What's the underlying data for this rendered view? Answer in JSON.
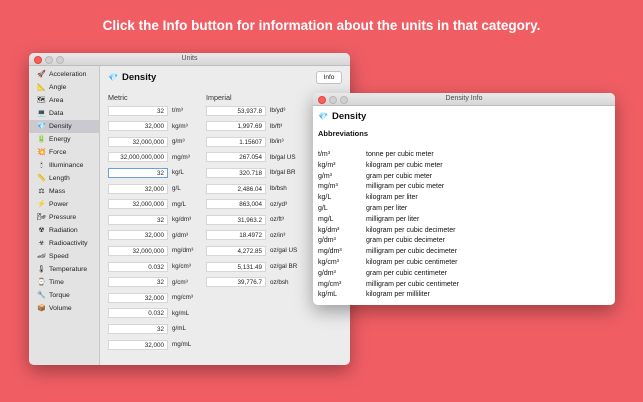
{
  "headline": "Click the Info button for information about the units in that category.",
  "colors": {
    "background": "#f05e64",
    "accent": "#6aa0e0",
    "selected_sidebar": "#c9c9cf"
  },
  "main_window": {
    "title": "Units",
    "sidebar": [
      {
        "label": "Acceleration",
        "icon": "rocket-icon",
        "glyph": "🚀"
      },
      {
        "label": "Angle",
        "icon": "angle-icon",
        "glyph": "📐"
      },
      {
        "label": "Area",
        "icon": "map-icon",
        "glyph": "🗺"
      },
      {
        "label": "Data",
        "icon": "monitor-icon",
        "glyph": "💻"
      },
      {
        "label": "Density",
        "icon": "diamond-icon",
        "glyph": "💎",
        "selected": true
      },
      {
        "label": "Energy",
        "icon": "battery-icon",
        "glyph": "🔋"
      },
      {
        "label": "Force",
        "icon": "force-icon",
        "glyph": "💥"
      },
      {
        "label": "Illuminance",
        "icon": "candle-icon",
        "glyph": "🕯"
      },
      {
        "label": "Length",
        "icon": "ruler-icon",
        "glyph": "📏"
      },
      {
        "label": "Mass",
        "icon": "scale-icon",
        "glyph": "⚖"
      },
      {
        "label": "Power",
        "icon": "power-icon",
        "glyph": "⚡"
      },
      {
        "label": "Pressure",
        "icon": "pressure-icon",
        "glyph": "🌬"
      },
      {
        "label": "Radiation",
        "icon": "radiation-icon",
        "glyph": "☢"
      },
      {
        "label": "Radioactivity",
        "icon": "radioactivity-icon",
        "glyph": "☣"
      },
      {
        "label": "Speed",
        "icon": "car-icon",
        "glyph": "🏎"
      },
      {
        "label": "Temperature",
        "icon": "thermometer-icon",
        "glyph": "🌡"
      },
      {
        "label": "Time",
        "icon": "watch-icon",
        "glyph": "⌚"
      },
      {
        "label": "Torque",
        "icon": "wrench-icon",
        "glyph": "🔧"
      },
      {
        "label": "Volume",
        "icon": "box-icon",
        "glyph": "📦"
      }
    ],
    "category": {
      "title": "Density",
      "icon": "diamond-icon",
      "glyph": "💎"
    },
    "info_button": "Info",
    "metric_header": "Metric",
    "imperial_header": "Imperial",
    "metric": [
      {
        "value": "32",
        "unit": "t/m³"
      },
      {
        "value": "32,000",
        "unit": "kg/m³"
      },
      {
        "value": "32,000,000",
        "unit": "g/m³"
      },
      {
        "value": "32,000,000,000",
        "unit": "mg/m³"
      },
      {
        "value": "32",
        "unit": "kg/L",
        "focused": true
      },
      {
        "value": "32,000",
        "unit": "g/L"
      },
      {
        "value": "32,000,000",
        "unit": "mg/L"
      },
      {
        "value": "32",
        "unit": "kg/dm³"
      },
      {
        "value": "32,000",
        "unit": "g/dm³"
      },
      {
        "value": "32,000,000",
        "unit": "mg/dm³"
      },
      {
        "value": "0.032",
        "unit": "kg/cm³"
      },
      {
        "value": "32",
        "unit": "g/cm³"
      },
      {
        "value": "32,000",
        "unit": "mg/cm³"
      },
      {
        "value": "0.032",
        "unit": "kg/mL"
      },
      {
        "value": "32",
        "unit": "g/mL"
      },
      {
        "value": "32,000",
        "unit": "mg/mL"
      }
    ],
    "imperial": [
      {
        "value": "53,937.8",
        "unit": "lb/yd³"
      },
      {
        "value": "1,997.69",
        "unit": "lb/ft³"
      },
      {
        "value": "1.15607",
        "unit": "lb/in³"
      },
      {
        "value": "267.054",
        "unit": "lb/gal US"
      },
      {
        "value": "320.718",
        "unit": "lb/gal BR"
      },
      {
        "value": "2,486.04",
        "unit": "lb/bsh"
      },
      {
        "value": "863,004",
        "unit": "oz/yd³"
      },
      {
        "value": "31,963.2",
        "unit": "oz/ft³"
      },
      {
        "value": "18.4972",
        "unit": "oz/in³"
      },
      {
        "value": "4,272.85",
        "unit": "oz/gal US"
      },
      {
        "value": "5,131.49",
        "unit": "oz/gal BR"
      },
      {
        "value": "39,776.7",
        "unit": "oz/bsh"
      }
    ]
  },
  "info_window": {
    "title": "Density Info",
    "heading": "Density",
    "glyph": "💎",
    "subheading": "Abbreviations",
    "abbreviations": [
      {
        "abbr": "t/m³",
        "desc": "tonne per cubic meter"
      },
      {
        "abbr": "kg/m³",
        "desc": "kilogram per cubic meter"
      },
      {
        "abbr": "g/m³",
        "desc": "gram per cubic meter"
      },
      {
        "abbr": "mg/m³",
        "desc": "milligram per cubic meter"
      },
      {
        "abbr": "kg/L",
        "desc": "kilogram per liter"
      },
      {
        "abbr": "g/L",
        "desc": "gram per liter"
      },
      {
        "abbr": "mg/L",
        "desc": "milligram per liter"
      },
      {
        "abbr": "kg/dm³",
        "desc": "kilogram per cubic decimeter"
      },
      {
        "abbr": "g/dm³",
        "desc": "gram per cubic decimeter"
      },
      {
        "abbr": "mg/dm³",
        "desc": "milligram per cubic decimeter"
      },
      {
        "abbr": "kg/cm³",
        "desc": "kilogram per cubic centimeter"
      },
      {
        "abbr": "g/dm³",
        "desc": "gram per cubic centimeter"
      },
      {
        "abbr": "mg/cm³",
        "desc": "milligram per cubic centimeter"
      },
      {
        "abbr": "kg/mL",
        "desc": "kilogram per milliliter"
      }
    ]
  }
}
